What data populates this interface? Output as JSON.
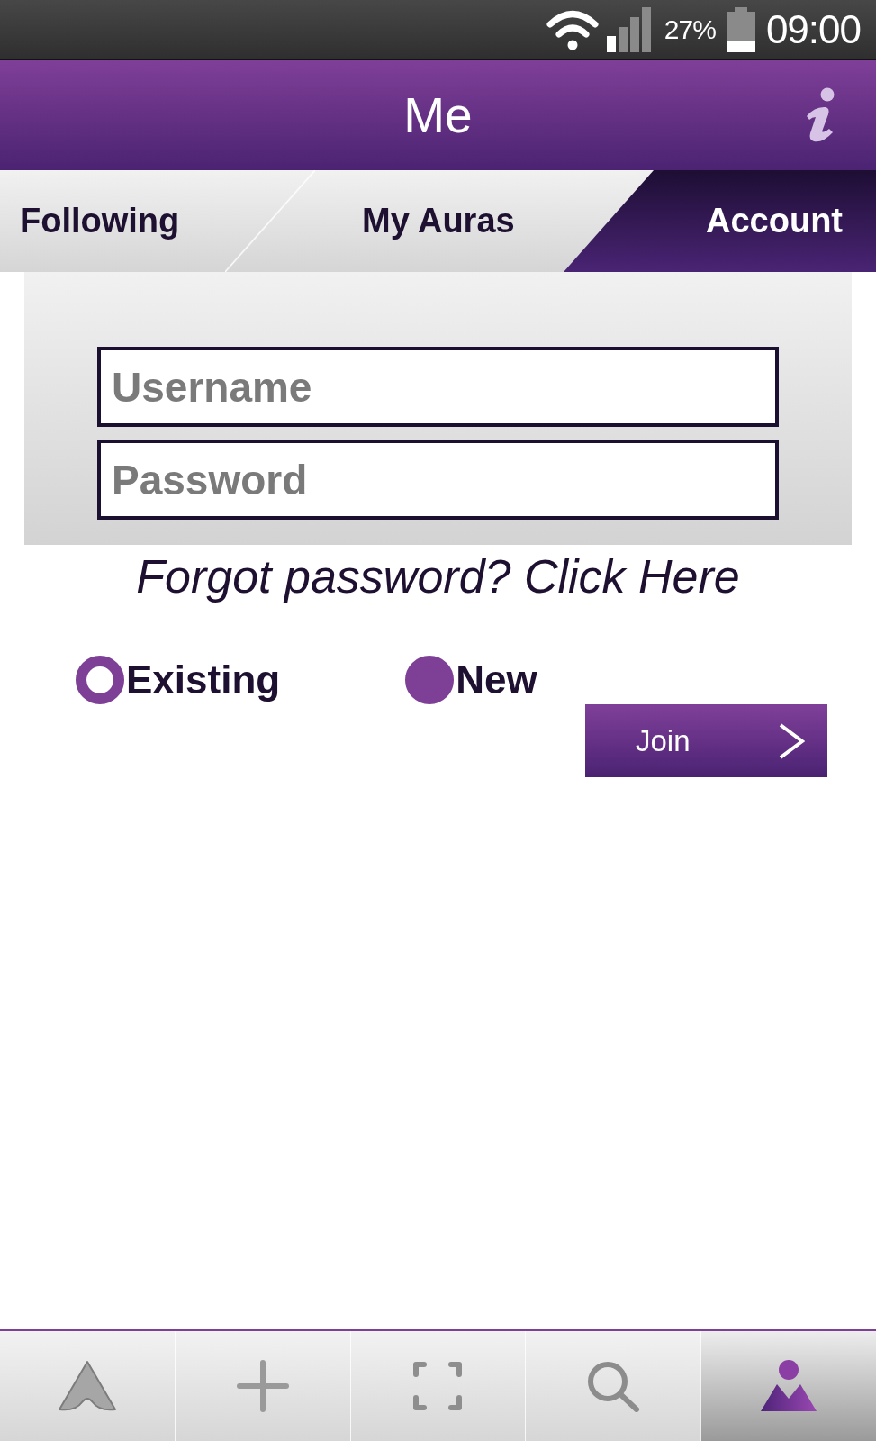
{
  "status_bar": {
    "battery_percent": "27%",
    "time": "09:00"
  },
  "header": {
    "title": "Me"
  },
  "tabs": [
    {
      "label": "Following",
      "selected": false
    },
    {
      "label": "My Auras",
      "selected": false
    },
    {
      "label": "Account",
      "selected": true
    }
  ],
  "login_form": {
    "username": {
      "placeholder": "Username"
    },
    "password": {
      "placeholder": "Password"
    }
  },
  "forgot_password_link": "Forgot password? Click Here",
  "account_type": [
    {
      "label": "Existing",
      "selected": false
    },
    {
      "label": "New",
      "selected": true
    }
  ],
  "join_button": {
    "label": "Join"
  },
  "bottom_nav": [
    {
      "kind": "triangle",
      "selected": false
    },
    {
      "kind": "plus",
      "selected": false
    },
    {
      "kind": "frame",
      "selected": false
    },
    {
      "kind": "search",
      "selected": false
    },
    {
      "kind": "person",
      "selected": true
    }
  ]
}
